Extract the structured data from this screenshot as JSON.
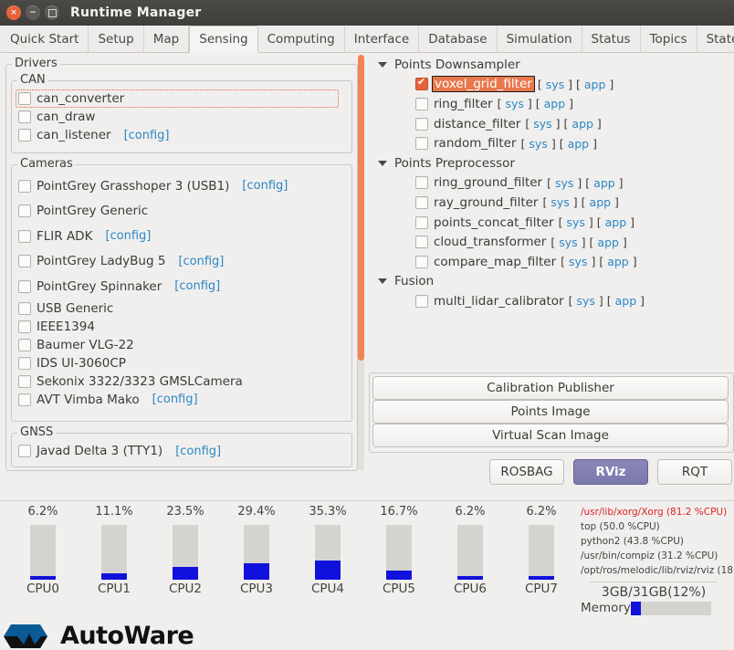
{
  "window": {
    "title": "Runtime Manager",
    "close_label": "×",
    "minimize_label": "−",
    "maximize_label": "□"
  },
  "tabs": [
    {
      "label": "Quick Start",
      "active": false
    },
    {
      "label": "Setup",
      "active": false
    },
    {
      "label": "Map",
      "active": false
    },
    {
      "label": "Sensing",
      "active": true
    },
    {
      "label": "Computing",
      "active": false
    },
    {
      "label": "Interface",
      "active": false
    },
    {
      "label": "Database",
      "active": false
    },
    {
      "label": "Simulation",
      "active": false
    },
    {
      "label": "Status",
      "active": false
    },
    {
      "label": "Topics",
      "active": false
    },
    {
      "label": "State",
      "active": false
    }
  ],
  "left_panel": {
    "drivers_title": "Drivers",
    "can": {
      "title": "CAN",
      "items": [
        {
          "label": "can_converter",
          "checked": false,
          "config": "",
          "focused": true
        },
        {
          "label": "can_draw",
          "checked": false,
          "config": "",
          "focused": false
        },
        {
          "label": "can_listener",
          "checked": false,
          "config": "[config]",
          "focused": false
        }
      ]
    },
    "cameras": {
      "title": "Cameras",
      "items": [
        {
          "label": "PointGrey Grasshoper 3 (USB1)",
          "checked": false,
          "config": "[config]"
        },
        {
          "label": "PointGrey Generic",
          "checked": false,
          "config": ""
        },
        {
          "label": "FLIR ADK",
          "checked": false,
          "config": "[config]"
        },
        {
          "label": "PointGrey LadyBug 5",
          "checked": false,
          "config": "[config]"
        },
        {
          "label": "PointGrey Spinnaker",
          "checked": false,
          "config": "[config]"
        },
        {
          "label": "USB Generic",
          "checked": false,
          "config": ""
        },
        {
          "label": "IEEE1394",
          "checked": false,
          "config": ""
        },
        {
          "label": "Baumer VLG-22",
          "checked": false,
          "config": ""
        },
        {
          "label": "IDS UI-3060CP",
          "checked": false,
          "config": ""
        },
        {
          "label": "Sekonix 3322/3323 GMSLCamera",
          "checked": false,
          "config": ""
        },
        {
          "label": "AVT Vimba Mako",
          "checked": false,
          "config": "[config]"
        }
      ]
    },
    "gnss": {
      "title": "GNSS",
      "items": [
        {
          "label": "Javad Delta 3 (TTY1)",
          "checked": false,
          "config": "[config]"
        }
      ]
    }
  },
  "right_panel": {
    "sys_label": "sys",
    "app_label": "app",
    "bracket_open": "[",
    "bracket_close": "]",
    "groups": [
      {
        "label": "Points Downsampler",
        "expanded": true,
        "items": [
          {
            "label": "voxel_grid_filter",
            "checked": true,
            "selected": true
          },
          {
            "label": "ring_filter",
            "checked": false,
            "selected": false
          },
          {
            "label": "distance_filter",
            "checked": false,
            "selected": false
          },
          {
            "label": "random_filter",
            "checked": false,
            "selected": false
          }
        ]
      },
      {
        "label": "Points Preprocessor",
        "expanded": true,
        "items": [
          {
            "label": "ring_ground_filter",
            "checked": false,
            "selected": false
          },
          {
            "label": "ray_ground_filter",
            "checked": false,
            "selected": false
          },
          {
            "label": "points_concat_filter",
            "checked": false,
            "selected": false
          },
          {
            "label": "cloud_transformer",
            "checked": false,
            "selected": false
          },
          {
            "label": "compare_map_filter",
            "checked": false,
            "selected": false
          }
        ]
      },
      {
        "label": "Fusion",
        "expanded": true,
        "items": [
          {
            "label": "multi_lidar_calibrator",
            "checked": false,
            "selected": false
          }
        ]
      }
    ],
    "action_buttons": [
      {
        "label": "Calibration Publisher"
      },
      {
        "label": "Points Image"
      },
      {
        "label": "Virtual Scan Image"
      }
    ],
    "launch_buttons": [
      {
        "label": "ROSBAG",
        "active": false
      },
      {
        "label": "RViz",
        "active": true
      },
      {
        "label": "RQT",
        "active": false
      }
    ]
  },
  "monitor": {
    "cpus": [
      {
        "name": "CPU0",
        "pct_label": "6.2%",
        "pct": 6.2
      },
      {
        "name": "CPU1",
        "pct_label": "11.1%",
        "pct": 11.1
      },
      {
        "name": "CPU2",
        "pct_label": "23.5%",
        "pct": 23.5
      },
      {
        "name": "CPU3",
        "pct_label": "29.4%",
        "pct": 29.4
      },
      {
        "name": "CPU4",
        "pct_label": "35.3%",
        "pct": 35.3
      },
      {
        "name": "CPU5",
        "pct_label": "16.7%",
        "pct": 16.7
      },
      {
        "name": "CPU6",
        "pct_label": "6.2%",
        "pct": 6.2
      },
      {
        "name": "CPU7",
        "pct_label": "6.2%",
        "pct": 6.2
      }
    ],
    "processes": [
      {
        "text": "/usr/lib/xorg/Xorg (81.2 %CPU)",
        "hot": true
      },
      {
        "text": "top (50.0 %CPU)",
        "hot": false
      },
      {
        "text": "python2 (43.8 %CPU)",
        "hot": false
      },
      {
        "text": "/usr/bin/compiz (31.2 %CPU)",
        "hot": false
      },
      {
        "text": "/opt/ros/melodic/lib/rviz/rviz (18",
        "hot": false
      }
    ],
    "memory": {
      "total_label": "3GB/31GB(12%)",
      "label": "Memory",
      "pct": 12
    }
  },
  "footer": {
    "logo_text": "AutoWare"
  },
  "colors": {
    "accent_orange": "#e8633a",
    "selection_orange": "#e8774c",
    "link_blue": "#2b87c4",
    "bar_blue": "#1111dd",
    "rviz_purple": "#7b78ac",
    "hot_red": "#dd2222",
    "logo_blue": "#0a5a96"
  }
}
